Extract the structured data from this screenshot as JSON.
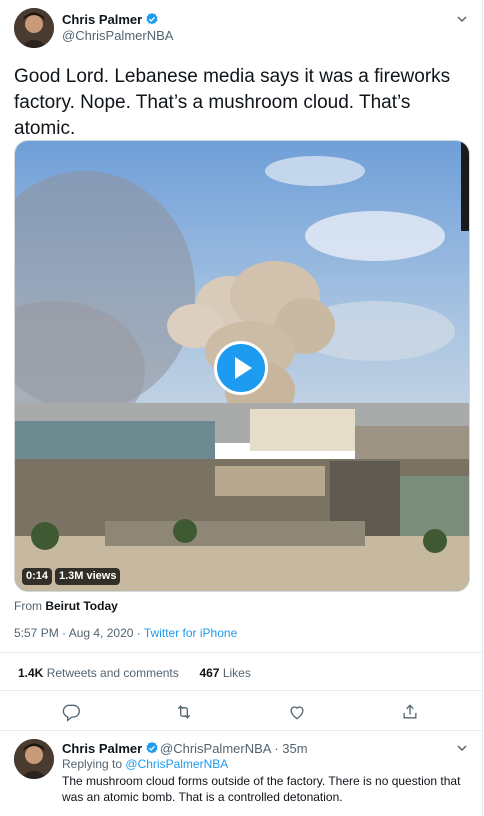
{
  "tweet": {
    "author_name": "Chris Palmer",
    "author_handle": "@ChrisPalmerNBA",
    "text": "Good Lord. Lebanese media says it was a fireworks factory. Nope. That’s a mushroom cloud. That’s atomic.",
    "video": {
      "time": "0:14",
      "views": "1.3M views"
    },
    "from_label": "From",
    "from_source": "Beirut Today",
    "timestamp": "5:57 PM · Aug 4, 2020 · ",
    "client": "Twitter for iPhone",
    "retweets_count": "1.4K",
    "retweets_label": "Retweets and comments",
    "likes_count": "467",
    "likes_label": "Likes"
  },
  "reply": {
    "author_name": "Chris Palmer",
    "author_handle": "@ChrisPalmerNBA · 35m",
    "replying_label": "Replying to",
    "replying_to": "@ChrisPalmerNBA",
    "text": "The mushroom cloud forms outside of the factory. There is no question that was an atomic bomb. That is a controlled detonation."
  },
  "colors": {
    "accent": "#1d9bf0",
    "secondary_text": "#536471",
    "divider": "#e6ecf0"
  },
  "icons": [
    "verified-badge-icon",
    "chevron-down-icon",
    "play-icon",
    "reply-icon",
    "retweet-icon",
    "like-icon",
    "share-icon"
  ]
}
